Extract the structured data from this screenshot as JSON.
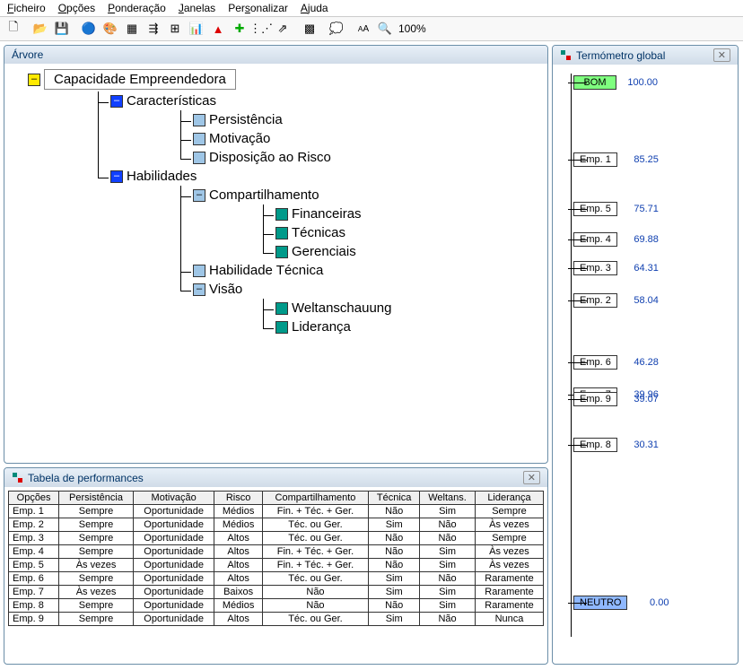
{
  "menu": {
    "items": [
      "Ficheiro",
      "Opções",
      "Ponderação",
      "Janelas",
      "Personalizar",
      "Ajuda"
    ]
  },
  "toolbar": {
    "buttons": [
      "new",
      "open",
      "save",
      "globe",
      "palette",
      "table",
      "tree1",
      "tree2",
      "chart",
      "triangle",
      "plus",
      "scatter",
      "line",
      "grid",
      "cloud",
      "font",
      "zoom"
    ],
    "zoom_label": "100%"
  },
  "tree_panel": {
    "title": "Árvore"
  },
  "tree": {
    "root": "Capacidade Empreendedora",
    "children": [
      {
        "label": "Características",
        "type": "blue",
        "children": [
          {
            "label": "Persistência",
            "type": "lblue"
          },
          {
            "label": "Motivação",
            "type": "lblue"
          },
          {
            "label": "Disposição ao Risco",
            "type": "lblue"
          }
        ]
      },
      {
        "label": "Habilidades",
        "type": "blue",
        "children": [
          {
            "label": "Compartilhamento",
            "type": "lblue",
            "children": [
              {
                "label": "Financeiras",
                "type": "teal"
              },
              {
                "label": "Técnicas",
                "type": "teal"
              },
              {
                "label": "Gerenciais",
                "type": "teal"
              }
            ]
          },
          {
            "label": "Habilidade Técnica",
            "type": "lblue"
          },
          {
            "label": "Visão",
            "type": "lblue",
            "children": [
              {
                "label": "Weltanschauung",
                "type": "teal"
              },
              {
                "label": "Liderança",
                "type": "teal"
              }
            ]
          }
        ]
      }
    ]
  },
  "perf_panel": {
    "title": "Tabela de performances"
  },
  "perf_table": {
    "headers": [
      "Opções",
      "Persistência",
      "Motivação",
      "Risco",
      "Compartilhamento",
      "Técnica",
      "Weltans.",
      "Liderança"
    ],
    "rows": [
      [
        "Emp. 1",
        "Sempre",
        "Oportunidade",
        "Médios",
        "Fin. + Téc. + Ger.",
        "Não",
        "Sim",
        "Sempre"
      ],
      [
        "Emp. 2",
        "Sempre",
        "Oportunidade",
        "Médios",
        "Téc. ou Ger.",
        "Sim",
        "Não",
        "Às vezes"
      ],
      [
        "Emp. 3",
        "Sempre",
        "Oportunidade",
        "Altos",
        "Téc. ou Ger.",
        "Não",
        "Não",
        "Sempre"
      ],
      [
        "Emp. 4",
        "Sempre",
        "Oportunidade",
        "Altos",
        "Fin. + Téc. + Ger.",
        "Não",
        "Sim",
        "Às vezes"
      ],
      [
        "Emp. 5",
        "Às vezes",
        "Oportunidade",
        "Altos",
        "Fin. + Téc. + Ger.",
        "Não",
        "Sim",
        "Às vezes"
      ],
      [
        "Emp. 6",
        "Sempre",
        "Oportunidade",
        "Altos",
        "Téc. ou Ger.",
        "Sim",
        "Não",
        "Raramente"
      ],
      [
        "Emp. 7",
        "Às vezes",
        "Oportunidade",
        "Baixos",
        "Não",
        "Sim",
        "Sim",
        "Raramente"
      ],
      [
        "Emp. 8",
        "Sempre",
        "Oportunidade",
        "Médios",
        "Não",
        "Não",
        "Sim",
        "Raramente"
      ],
      [
        "Emp. 9",
        "Sempre",
        "Oportunidade",
        "Altos",
        "Téc. ou Ger.",
        "Sim",
        "Não",
        "Nunca"
      ]
    ]
  },
  "thermo_panel": {
    "title": "Termómetro global"
  },
  "chart_data": {
    "type": "bar",
    "title": "Termómetro global",
    "xlabel": "",
    "ylabel": "",
    "ylim": [
      0,
      100
    ],
    "categories": [
      "BOM",
      "Emp. 1",
      "Emp. 5",
      "Emp. 4",
      "Emp. 3",
      "Emp. 2",
      "Emp. 6",
      "Emp. 7",
      "Emp. 9",
      "Emp. 8",
      "NEUTRO"
    ],
    "values": [
      100.0,
      85.25,
      75.71,
      69.88,
      64.31,
      58.04,
      46.28,
      39.96,
      39.07,
      30.31,
      0.0
    ],
    "series": [
      {
        "name": "global",
        "values": [
          100.0,
          85.25,
          75.71,
          69.88,
          64.31,
          58.04,
          46.28,
          39.96,
          39.07,
          30.31,
          0.0
        ]
      }
    ],
    "special": {
      "BOM": "green",
      "NEUTRO": "bluebg"
    }
  }
}
